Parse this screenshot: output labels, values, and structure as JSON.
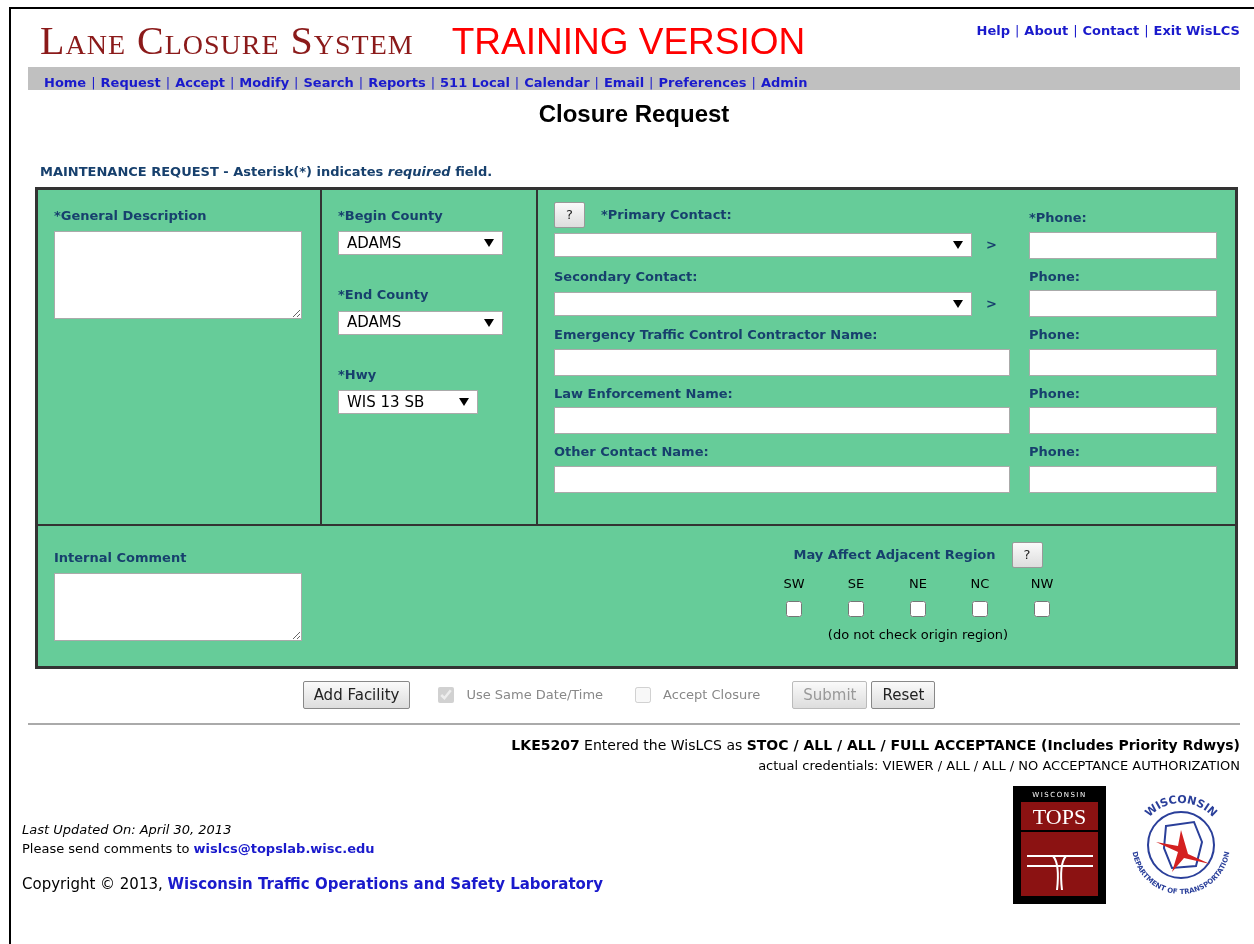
{
  "header": {
    "title": "Lane Closure System",
    "training_label": "TRAINING VERSION",
    "separator": "|",
    "top_links": [
      "Help",
      "About",
      "Contact",
      "Exit WisLCS"
    ]
  },
  "nav": {
    "items": [
      "Home",
      "Request",
      "Accept",
      "Modify",
      "Search",
      "Reports",
      "511 Local",
      "Calendar",
      "Email",
      "Preferences",
      "Admin"
    ]
  },
  "page_title": "Closure Request",
  "form_note": "MAINTENANCE REQUEST - Asterisk(*) indicates *required* field.",
  "form": {
    "description": {
      "label": "*General Description"
    },
    "begin_county": {
      "label": "*Begin County",
      "value": "ADAMS"
    },
    "end_county": {
      "label": "*End County",
      "value": "ADAMS"
    },
    "hwy": {
      "label": "*Hwy",
      "value": "WIS 13 SB"
    },
    "help_button": "?",
    "contacts": [
      {
        "kind": "select",
        "label": "*Primary Contact:",
        "arrow": ">",
        "phone_label": "*Phone:"
      },
      {
        "kind": "select",
        "label": "Secondary Contact:",
        "arrow": ">",
        "phone_label": "Phone:"
      },
      {
        "kind": "input",
        "label": "Emergency Traffic Control Contractor Name:",
        "phone_label": "Phone:"
      },
      {
        "kind": "input",
        "label": "Law Enforcement Name:",
        "phone_label": "Phone:"
      },
      {
        "kind": "input",
        "label": "Other Contact Name:",
        "phone_label": "Phone:"
      }
    ],
    "internal_comment": {
      "label": "Internal Comment"
    },
    "regions": {
      "label": "May Affect Adjacent Region",
      "help_button": "?",
      "note": "(do not check origin region)",
      "items": [
        {
          "code": "SW",
          "checked": false
        },
        {
          "code": "SE",
          "checked": false
        },
        {
          "code": "NE",
          "checked": false
        },
        {
          "code": "NC",
          "checked": false
        },
        {
          "code": "NW",
          "checked": false
        }
      ]
    }
  },
  "actions": [
    {
      "kind": "button",
      "label": "Add Facility",
      "disabled": false
    },
    {
      "kind": "checkbox",
      "label": "Use Same Date/Time",
      "checked": true,
      "disabled": true
    },
    {
      "kind": "checkbox",
      "label": "Accept Closure",
      "checked": false,
      "disabled": true
    },
    {
      "kind": "button",
      "label": "Submit",
      "disabled": true
    },
    {
      "kind": "button",
      "label": "Reset",
      "disabled": false
    }
  ],
  "session": {
    "entered": "**LKE5207** Entered the WisLCS as **STOC / ALL / ALL / FULL ACCEPTANCE (Includes Priority Rdwys)**",
    "credentials": "actual credentials:  VIEWER / ALL / ALL / NO ACCEPTANCE AUTHORIZATION"
  },
  "footer": {
    "last_updated": "Last Updated On: April 30, 2013",
    "comments_text": "Please send comments to",
    "email": "wislcs@topslab.wisc.edu",
    "copyright": "Copyright © 2013,",
    "org": "Wisconsin Traffic Operations and Safety Laboratory",
    "logos": [
      {
        "kind": "tops",
        "top": "WISCONSIN",
        "name": "TOPS"
      },
      {
        "kind": "dot",
        "top": "WISCONSIN",
        "bottom": "DEPARTMENT OF TRANSPORTATION"
      }
    ]
  }
}
